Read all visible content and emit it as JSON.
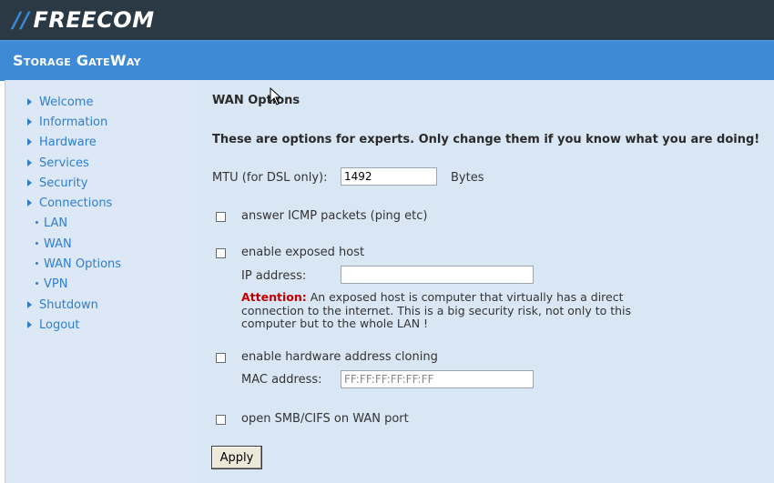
{
  "header": {
    "logo_bars": "//",
    "logo_text": "FREECOM",
    "app_title": "Storage GateWay"
  },
  "sidebar": {
    "items": [
      {
        "label": "Welcome"
      },
      {
        "label": "Information"
      },
      {
        "label": "Hardware"
      },
      {
        "label": "Services"
      },
      {
        "label": "Security"
      },
      {
        "label": "Connections"
      },
      {
        "label": "Shutdown"
      },
      {
        "label": "Logout"
      }
    ],
    "subitems": [
      {
        "label": "LAN"
      },
      {
        "label": "WAN"
      },
      {
        "label": "WAN Options"
      },
      {
        "label": "VPN"
      }
    ]
  },
  "main": {
    "heading": "WAN Options",
    "warning": "These are options for experts. Only change them if you know what you are doing!",
    "mtu": {
      "label": "MTU (for DSL only):",
      "value": "1492",
      "unit": "Bytes"
    },
    "icmp": {
      "label": "answer ICMP packets (ping etc)",
      "checked": false
    },
    "exposed_host": {
      "label": "enable exposed host",
      "checked": false,
      "ip_label": "IP address:",
      "ip_value": "",
      "attention_label": "Attention:",
      "attention_text": " An exposed host is computer that virtually has a direct connection to the internet. This is a big security risk, not only to this computer but to the whole LAN !"
    },
    "mac_clone": {
      "label": "enable hardware address cloning",
      "checked": false,
      "mac_label": "MAC address:",
      "mac_value": "FF:FF:FF:FF:FF:FF"
    },
    "smb": {
      "label": "open SMB/CIFS on WAN port",
      "checked": false
    },
    "apply_label": "Apply"
  },
  "icons": {
    "nav_bullet": "triangle-right-icon",
    "sub_bullet": "dot-icon",
    "cursor": "mouse-pointer-icon"
  },
  "colors": {
    "topbar": "#2b3945",
    "titlebar": "#3e8ad6",
    "link": "#2f7ecf",
    "attention": "#c00000",
    "pane": "#d9e7f5"
  }
}
